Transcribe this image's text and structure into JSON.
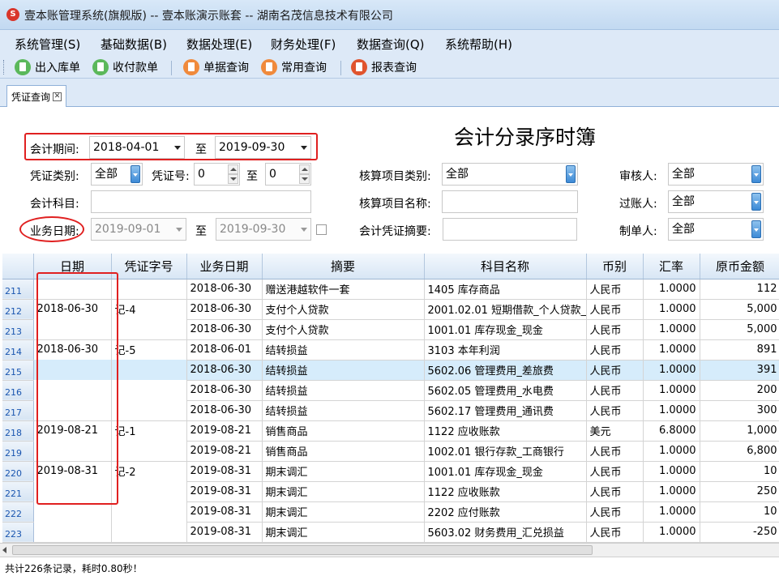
{
  "window": {
    "title": "壹本账管理系统(旗舰版) -- 壹本账演示账套 -- 湖南名茂信息技术有限公司"
  },
  "menu": [
    "系统管理(S)",
    "基础数据(B)",
    "数据处理(E)",
    "财务处理(F)",
    "数据查询(Q)",
    "系统帮助(H)"
  ],
  "toolbar": {
    "buttons": [
      {
        "label": "出入库单",
        "icon": "stock-doc-icon",
        "color": "#5bb85b"
      },
      {
        "label": "收付款单",
        "icon": "payment-icon",
        "color": "#5bb85b"
      },
      {
        "label": "单据查询",
        "icon": "doc-query-icon",
        "color": "#f08a3c"
      },
      {
        "label": "常用查询",
        "icon": "common-query-icon",
        "color": "#f08a3c"
      },
      {
        "label": "报表查询",
        "icon": "report-query-icon",
        "color": "#e0542e"
      }
    ]
  },
  "tab": {
    "label": "凭证查询",
    "close": "✕"
  },
  "filter": {
    "title": "会计分录序时簿",
    "period_label": "会计期间:",
    "period_from": "2018-04-01",
    "to_label": "至",
    "period_to": "2019-09-30",
    "voucher_type_label": "凭证类别:",
    "voucher_type": "全部",
    "voucher_no_label": "凭证号:",
    "voucher_no_from": "0",
    "voucher_no_to": "0",
    "account_label": "会计科目:",
    "account_value": "",
    "biz_date_label": "业务日期:",
    "biz_date_from": "2019-09-01",
    "biz_date_to": "2019-09-30",
    "item_type_label": "核算项目类别:",
    "item_type": "全部",
    "item_name_label": "核算项目名称:",
    "item_name": "",
    "summary_label": "会计凭证摘要:",
    "summary": "",
    "reviewer_label": "审核人:",
    "reviewer": "全部",
    "poster_label": "过账人:",
    "poster": "全部",
    "maker_label": "制单人:",
    "maker": "全部"
  },
  "table": {
    "columns": [
      "",
      "日期",
      "凭证字号",
      "业务日期",
      "摘要",
      "科目名称",
      "币别",
      "汇率",
      "原币金额"
    ],
    "rows": [
      {
        "n": "211",
        "date": "",
        "vno": "",
        "bdate": "2018-06-30",
        "summary": "赠送港越软件一套",
        "account": "1405 库存商品",
        "cur": "人民币",
        "rate": "1.0000",
        "amt": "112"
      },
      {
        "n": "212",
        "date": "2018-06-30",
        "vno": "记-4",
        "bdate": "2018-06-30",
        "summary": "支付个人贷款",
        "account": "2001.02.01 短期借款_个人贷款_",
        "cur": "人民币",
        "rate": "1.0000",
        "amt": "5,000"
      },
      {
        "n": "213",
        "date": "",
        "vno": "",
        "bdate": "2018-06-30",
        "summary": "支付个人贷款",
        "account": "1001.01 库存现金_现金",
        "cur": "人民币",
        "rate": "1.0000",
        "amt": "5,000"
      },
      {
        "n": "214",
        "date": "2018-06-30",
        "vno": "记-5",
        "bdate": "2018-06-01",
        "summary": "结转损益",
        "account": "3103 本年利润",
        "cur": "人民币",
        "rate": "1.0000",
        "amt": "891"
      },
      {
        "n": "215",
        "date": "",
        "vno": "",
        "bdate": "2018-06-30",
        "summary": "结转损益",
        "account": "5602.06 管理费用_差旅费",
        "cur": "人民币",
        "rate": "1.0000",
        "amt": "391"
      },
      {
        "n": "216",
        "date": "",
        "vno": "",
        "bdate": "2018-06-30",
        "summary": "结转损益",
        "account": "5602.05 管理费用_水电费",
        "cur": "人民币",
        "rate": "1.0000",
        "amt": "200"
      },
      {
        "n": "217",
        "date": "",
        "vno": "",
        "bdate": "2018-06-30",
        "summary": "结转损益",
        "account": "5602.17 管理费用_通讯费",
        "cur": "人民币",
        "rate": "1.0000",
        "amt": "300"
      },
      {
        "n": "218",
        "date": "2019-08-21",
        "vno": "记-1",
        "bdate": "2019-08-21",
        "summary": "销售商品",
        "account": "1122 应收账款",
        "cur": "美元",
        "rate": "6.8000",
        "amt": "1,000"
      },
      {
        "n": "219",
        "date": "",
        "vno": "",
        "bdate": "2019-08-21",
        "summary": "销售商品",
        "account": "1002.01 银行存款_工商银行",
        "cur": "人民币",
        "rate": "1.0000",
        "amt": "6,800"
      },
      {
        "n": "220",
        "date": "2019-08-31",
        "vno": "记-2",
        "bdate": "2019-08-31",
        "summary": "期末调汇",
        "account": "1001.01 库存现金_现金",
        "cur": "人民币",
        "rate": "1.0000",
        "amt": "10"
      },
      {
        "n": "221",
        "date": "",
        "vno": "",
        "bdate": "2019-08-31",
        "summary": "期末调汇",
        "account": "1122 应收账款",
        "cur": "人民币",
        "rate": "1.0000",
        "amt": "250"
      },
      {
        "n": "222",
        "date": "",
        "vno": "",
        "bdate": "2019-08-31",
        "summary": "期末调汇",
        "account": "2202 应付账款",
        "cur": "人民币",
        "rate": "1.0000",
        "amt": "10"
      },
      {
        "n": "223",
        "date": "",
        "vno": "",
        "bdate": "2019-08-31",
        "summary": "期末调汇",
        "account": "5603.02 财务费用_汇兑损益",
        "cur": "人民币",
        "rate": "1.0000",
        "amt": "-250"
      }
    ]
  },
  "status": "共计226条记录，耗时0.80秒！",
  "colors": {
    "highlight": "#e02020",
    "selected_row": "#d6ecfb",
    "accent": "#2b6fb4"
  }
}
